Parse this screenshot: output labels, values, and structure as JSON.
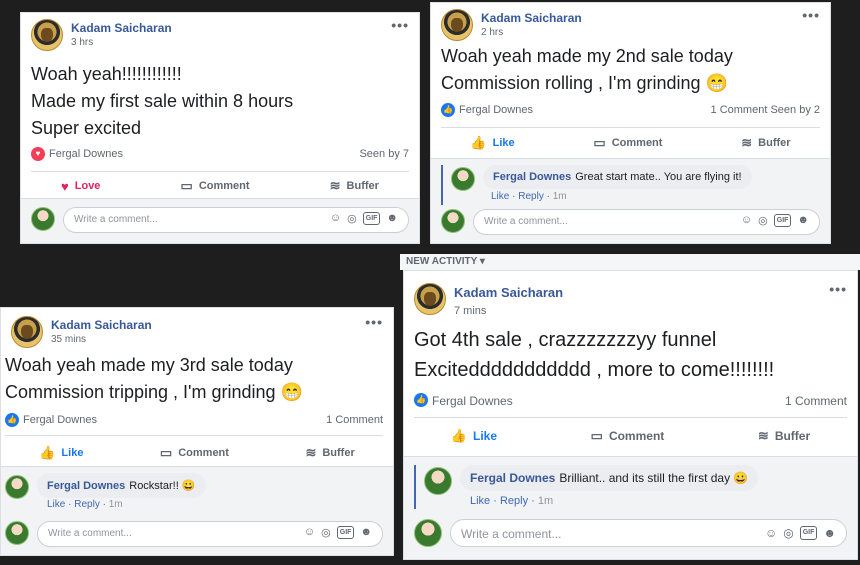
{
  "posts": [
    {
      "author": "Kadam Saicharan",
      "time": "3 hrs",
      "lines": [
        "Woah yeah!!!!!!!!!!!!",
        "Made my first sale within 8 hours",
        "Super excited"
      ],
      "reaction_icon": "heart-reaction-icon",
      "reactor": "Fergal Downes",
      "seen": "Seen by 7",
      "actions": {
        "first": "Love",
        "second": "Comment",
        "third": "Buffer"
      },
      "comment_placeholder": "Write a comment..."
    },
    {
      "author": "Kadam Saicharan",
      "time": "2 hrs",
      "lines": [
        "Woah yeah made my 2nd sale today",
        "Commission rolling , I'm grinding 😁"
      ],
      "reaction_icon": "like-reaction-icon",
      "reactor": "Fergal Downes",
      "count": "1 Comment",
      "seen": "Seen by 2",
      "actions": {
        "first": "Like",
        "second": "Comment",
        "third": "Buffer"
      },
      "comment": {
        "author": "Fergal Downes",
        "text": "Great start mate.. You are flying it!",
        "like": "Like",
        "reply": "Reply",
        "time": "1m"
      },
      "comment_placeholder": "Write a comment..."
    },
    {
      "author": "Kadam Saicharan",
      "time": "35 mins",
      "lines": [
        "Woah yeah made my 3rd sale today",
        "Commission tripping , I'm grinding 😁"
      ],
      "reaction_icon": "like-reaction-icon",
      "reactor": "Fergal Downes",
      "count": "1 Comment",
      "actions": {
        "first": "Like",
        "second": "Comment",
        "third": "Buffer"
      },
      "comment": {
        "author": "Fergal Downes",
        "text": "Rockstar!! 😀",
        "like": "Like",
        "reply": "Reply",
        "time": "1m"
      },
      "comment_placeholder": "Write a comment..."
    },
    {
      "section_label": "NEW ACTIVITY ▾",
      "author": "Kadam Saicharan",
      "time": "7 mins",
      "lines": [
        "Got 4th sale , crazzzzzzzyy funnel",
        "Exciteddddddddddd , more to come!!!!!!!!"
      ],
      "reaction_icon": "like-reaction-icon",
      "reactor": "Fergal Downes",
      "count": "1 Comment",
      "actions": {
        "first": "Like",
        "second": "Comment",
        "third": "Buffer"
      },
      "comment": {
        "author": "Fergal Downes",
        "text": "Brilliant.. and its still the first day 😀",
        "like": "Like",
        "reply": "Reply",
        "time": "1m"
      },
      "comment_placeholder": "Write a comment..."
    }
  ],
  "icons": {
    "more": "more-options-icon",
    "camera": "camera-icon",
    "gif": "GIF",
    "sticker": "sticker-icon",
    "emoji": "emoji-icon"
  },
  "colors": {
    "link": "#385898",
    "like": "#1877f2",
    "love": "#e0245e"
  }
}
